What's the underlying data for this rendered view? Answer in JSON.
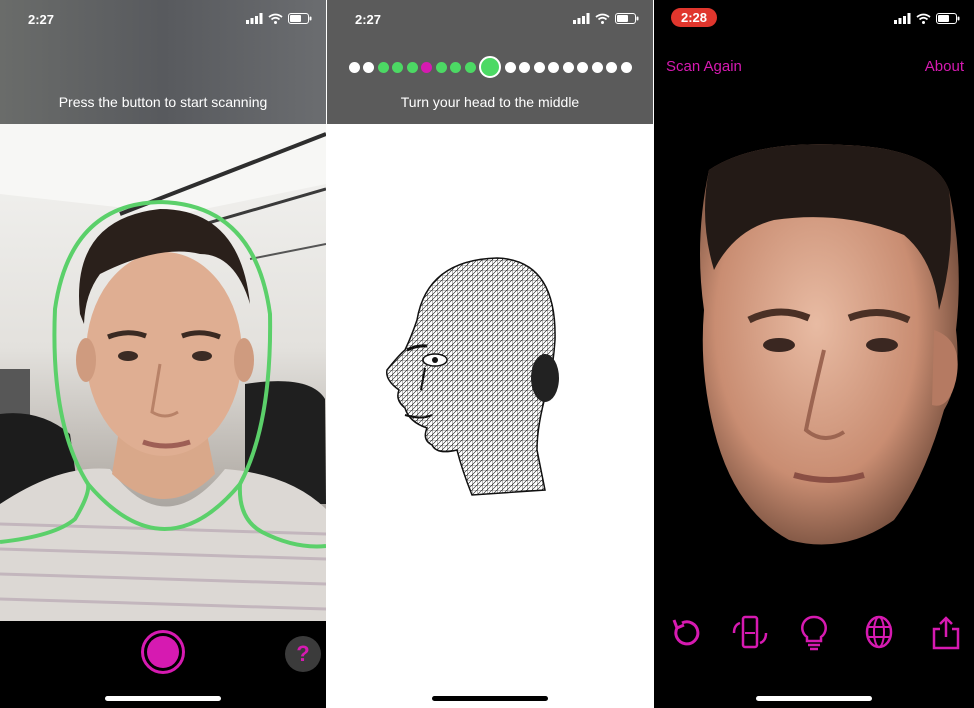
{
  "screens": [
    {
      "id": "scan-start",
      "status_time": "2:27",
      "prompt": "Press the button to start scanning",
      "record_button": "record",
      "help_label": "?"
    },
    {
      "id": "scanning",
      "status_time": "2:27",
      "prompt": "Turn your head to the middle",
      "progress_dots": [
        "white",
        "white",
        "green",
        "green",
        "green",
        "magenta",
        "green",
        "green",
        "green",
        "current",
        "white",
        "white",
        "white",
        "white",
        "white",
        "white",
        "white",
        "white",
        "white"
      ]
    },
    {
      "id": "result",
      "status_time": "2:28",
      "nav": {
        "left": "Scan Again",
        "right": "About"
      },
      "toolbar_icons": [
        "rotate-icon",
        "phone-rotate-icon",
        "lightbulb-icon",
        "mesh-globe-icon",
        "share-icon"
      ]
    }
  ],
  "colors": {
    "accent": "#d61ab1",
    "face_guide": "#5bd06a",
    "progress_green": "#4cd964",
    "recording_pill": "#e0362d"
  }
}
